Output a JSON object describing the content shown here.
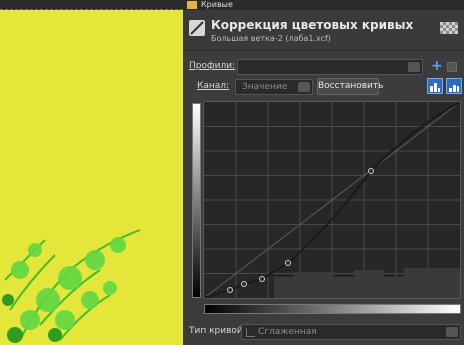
{
  "top_window": {
    "title": "Кривые"
  },
  "dialog": {
    "title": "Коррекция цветовых кривых",
    "subtitle": "Большая ветка-2 (лаба1.xcf)"
  },
  "profiles": {
    "label": "Профили:",
    "value": ""
  },
  "channel": {
    "label": "Канал:",
    "selected": "Значение",
    "reset_label": "Восстановить"
  },
  "curve_type": {
    "label": "Тип кривой:",
    "selected": "Сглаженная"
  },
  "colors": {
    "image_bg": "#e4e63a",
    "dialog_bg": "#3c3c3c",
    "accent": "#4aa3ff"
  }
}
